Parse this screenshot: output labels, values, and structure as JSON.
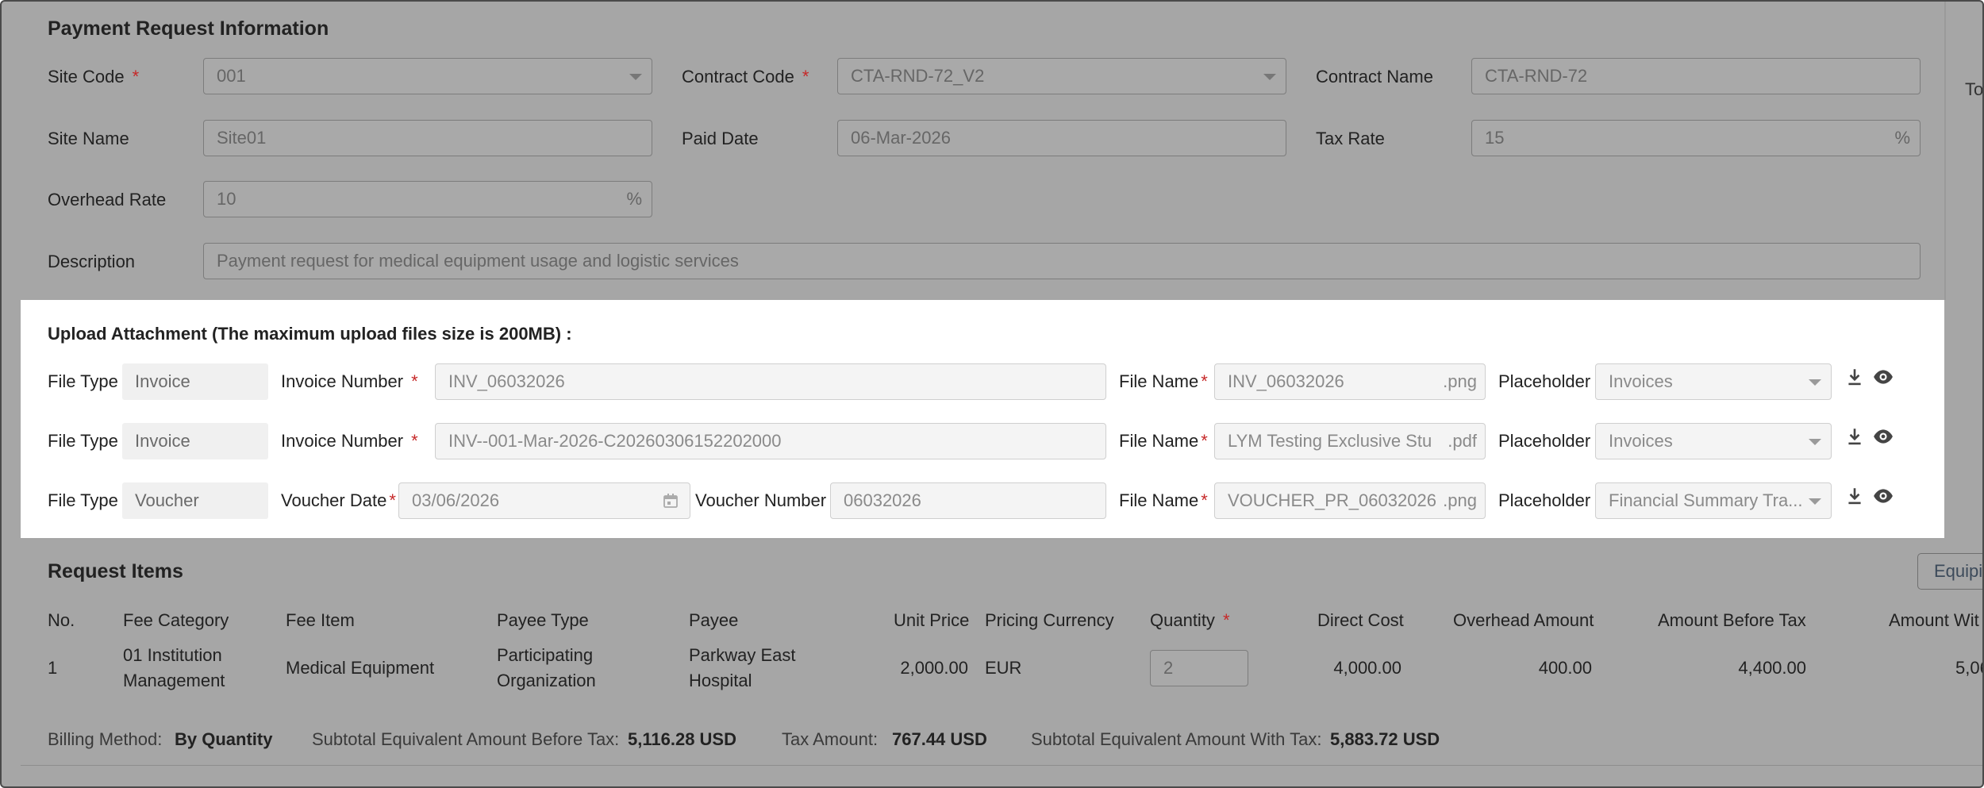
{
  "payment_info": {
    "title": "Payment Request Information",
    "site_code": {
      "label": "Site Code",
      "value": "001"
    },
    "contract_code": {
      "label": "Contract Code",
      "value": "CTA-RND-72_V2"
    },
    "contract_name": {
      "label": "Contract Name",
      "value": "CTA-RND-72"
    },
    "site_name": {
      "label": "Site Name",
      "value": "Site01"
    },
    "paid_date": {
      "label": "Paid Date",
      "value": "06-Mar-2026"
    },
    "tax_rate": {
      "label": "Tax Rate",
      "value": "15",
      "unit": "%"
    },
    "overhead_rate": {
      "label": "Overhead Rate",
      "value": "10",
      "unit": "%"
    },
    "description": {
      "label": "Description",
      "value": "Payment request for medical equipment usage and logistic services"
    },
    "right_cut_text": "To",
    "required_mark": "*"
  },
  "upload": {
    "title": "Upload Attachment (The maximum upload files size is 200MB) :",
    "rows": [
      {
        "file_type_label": "File Type",
        "file_type": "Invoice",
        "number_label": "Invoice Number",
        "number": "INV_06032026",
        "file_name_label": "File Name",
        "file_name": "INV_06032026",
        "file_ext": ".png",
        "placeholder_label": "Placeholder",
        "placeholder": "Invoices"
      },
      {
        "file_type_label": "File Type",
        "file_type": "Invoice",
        "number_label": "Invoice Number",
        "number": "INV--001-Mar-2026-C20260306152202000",
        "file_name_label": "File Name",
        "file_name": "LYM Testing Exclusive Stu",
        "file_ext": ".pdf",
        "placeholder_label": "Placeholder",
        "placeholder": "Invoices"
      },
      {
        "file_type_label": "File Type",
        "file_type": "Voucher",
        "date_label": "Voucher Date",
        "date": "03/06/2026",
        "number_label": "Voucher Number",
        "number": "06032026",
        "file_name_label": "File Name",
        "file_name": "VOUCHER_PR_06032026",
        "file_ext": ".png",
        "placeholder_label": "Placeholder",
        "placeholder": "Financial Summary Tra..."
      }
    ],
    "icons": [
      "download-icon",
      "eye-icon"
    ]
  },
  "request_items": {
    "title": "Request Items",
    "right_button_label": "Equipi",
    "columns": [
      "No.",
      "Fee Category",
      "Fee Item",
      "Payee Type",
      "Payee",
      "Unit Price",
      "Pricing Currency",
      "Quantity",
      "Direct Cost",
      "Overhead Amount",
      "Amount Before Tax",
      "Amount Wit"
    ],
    "rows": [
      {
        "no": "1",
        "fee_category_line1": "01 Institution",
        "fee_category_line2": "Management",
        "fee_item": "Medical Equipment",
        "payee_type_line1": "Participating",
        "payee_type_line2": "Organization",
        "payee_line1": "Parkway East",
        "payee_line2": "Hospital",
        "unit_price": "2,000.00",
        "currency": "EUR",
        "quantity": "2",
        "direct_cost": "4,000.00",
        "overhead_amount": "400.00",
        "amount_before_tax": "4,400.00",
        "amount_with_tax": "5,06"
      }
    ],
    "summary": {
      "billing_method_label": "Billing Method:",
      "billing_method": "By Quantity",
      "subtotal_before_label": "Subtotal Equivalent Amount Before Tax:",
      "subtotal_before": "5,116.28 USD",
      "tax_amount_label": "Tax Amount:",
      "tax_amount": "767.44 USD",
      "subtotal_with_label": "Subtotal Equivalent Amount With Tax:",
      "subtotal_with": "5,883.72 USD"
    }
  },
  "colors": {
    "overlay": "#a6a6a6",
    "required": "#c62828",
    "panel": "#ffffff"
  }
}
